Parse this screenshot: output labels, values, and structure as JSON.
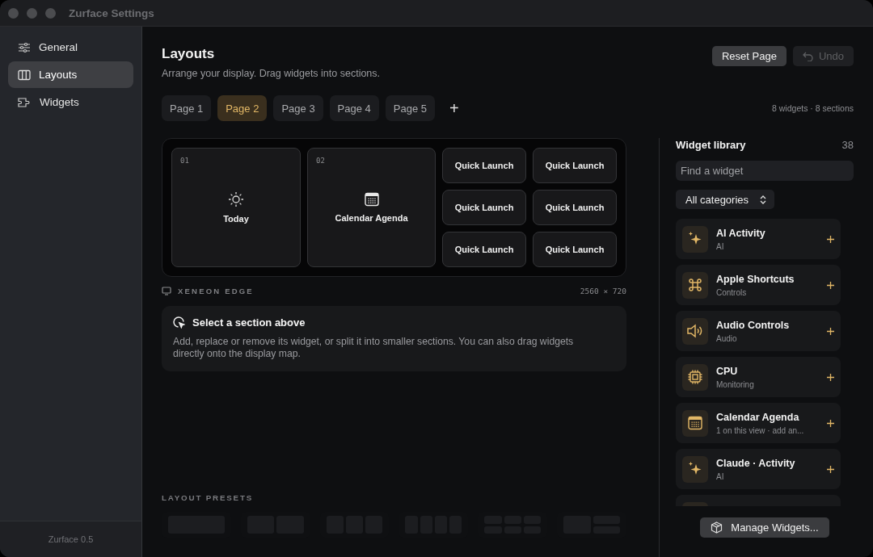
{
  "window": {
    "title": "Zurface Settings"
  },
  "sidebar": {
    "items": [
      {
        "label": "General",
        "selected": false
      },
      {
        "label": "Layouts",
        "selected": true
      },
      {
        "label": "Widgets",
        "selected": false
      }
    ],
    "footer": "Zurface 0.5"
  },
  "header": {
    "title": "Layouts",
    "subtitle": "Arrange your display. Drag widgets into sections.",
    "buttons": [
      {
        "label": "Reset Page",
        "disabled": false
      },
      {
        "label": "Undo",
        "disabled": true
      }
    ]
  },
  "tabs": [
    {
      "label": "Page 1",
      "selected": false
    },
    {
      "label": "Page 2",
      "selected": true
    },
    {
      "label": "Page 3",
      "selected": false
    },
    {
      "label": "Page 4",
      "selected": false
    },
    {
      "label": "Page 5",
      "selected": false
    }
  ],
  "add_tab": "+",
  "summary": "8 widgets · 8 sections",
  "display_map": {
    "sections": [
      {
        "kind": "large",
        "number": "01",
        "label": "Today"
      },
      {
        "kind": "large",
        "number": "02",
        "label": "Calendar Agenda"
      },
      {
        "kind": "small",
        "label": "Quick Launch"
      },
      {
        "kind": "small",
        "label": "Quick Launch"
      },
      {
        "kind": "small",
        "label": "Quick Launch"
      },
      {
        "kind": "small",
        "label": "Quick Launch"
      },
      {
        "kind": "small",
        "label": "Quick Launch"
      },
      {
        "kind": "small",
        "label": "Quick Launch"
      }
    ],
    "device": "XENEON EDGE",
    "resolution": "2560 × 720"
  },
  "info": {
    "title": "Select a section above",
    "text": "Add, replace or remove its widget, or split it into smaller sections. You can also drag widgets directly onto the display map."
  },
  "presets": {
    "title": "LAYOUT PRESETS",
    "items": [
      {
        "kind": "one"
      },
      {
        "kind": "two"
      },
      {
        "kind": "three"
      },
      {
        "kind": "four"
      },
      {
        "kind": "grid"
      },
      {
        "kind": "mixed"
      }
    ]
  },
  "library": {
    "title": "Widget library",
    "count": "38",
    "search": {
      "placeholder": "Find a widget"
    },
    "category": "All categories",
    "items": [
      {
        "name": "AI Activity",
        "category": "AI"
      },
      {
        "name": "Apple Shortcuts",
        "category": "Controls"
      },
      {
        "name": "Audio Controls",
        "category": "Audio"
      },
      {
        "name": "CPU",
        "category": "Monitoring"
      },
      {
        "name": "Calendar Agenda",
        "category": "1 on this view · add an..."
      },
      {
        "name": "Claude · Activity",
        "category": "AI"
      }
    ],
    "manage": "Manage Widgets..."
  }
}
